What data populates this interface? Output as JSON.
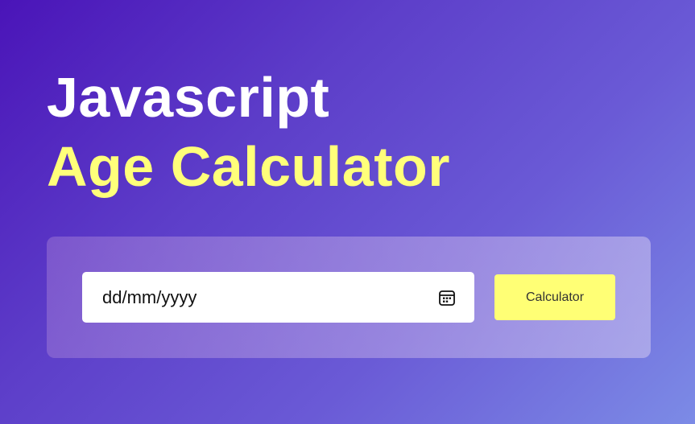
{
  "heading": {
    "line1": "Javascript",
    "line2": "Age Calculator"
  },
  "form": {
    "date_placeholder": "dd/mm/yyyy",
    "calendar_icon": "calendar-icon",
    "button_label": "Calculator"
  },
  "colors": {
    "accent": "#ffff7a",
    "background_start": "#4a14b8",
    "background_end": "#7c8be6"
  }
}
